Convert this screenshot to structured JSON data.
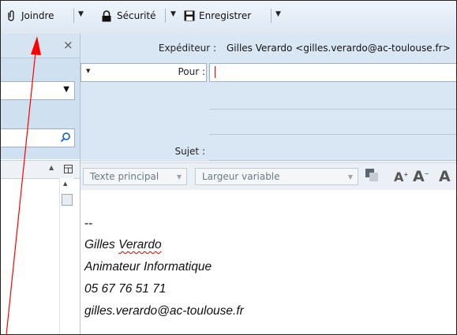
{
  "toolbar": {
    "attach_label": "Joindre",
    "security_label": "Sécurité",
    "save_label": "Enregistrer"
  },
  "sidebar": {
    "close_glyph": "×"
  },
  "compose": {
    "from_label": "Expéditeur :",
    "from_value": "Gilles Verardo <gilles.verardo@ac-toulouse.fr>",
    "to_label": "Pour :",
    "to_value": "",
    "subject_label": "Sujet :",
    "subject_value": ""
  },
  "format": {
    "paragraph_style": "Texte principal",
    "font": "Largeur variable"
  },
  "signature": {
    "separator": "--",
    "name": "Gilles Verardo",
    "title": "Animateur Informatique",
    "phone": "05 67 76 51 71",
    "email": "gilles.verardo@ac-toulouse.fr"
  },
  "colors": {
    "annotation": "#ff0000",
    "spellcheck": "#d00000"
  }
}
